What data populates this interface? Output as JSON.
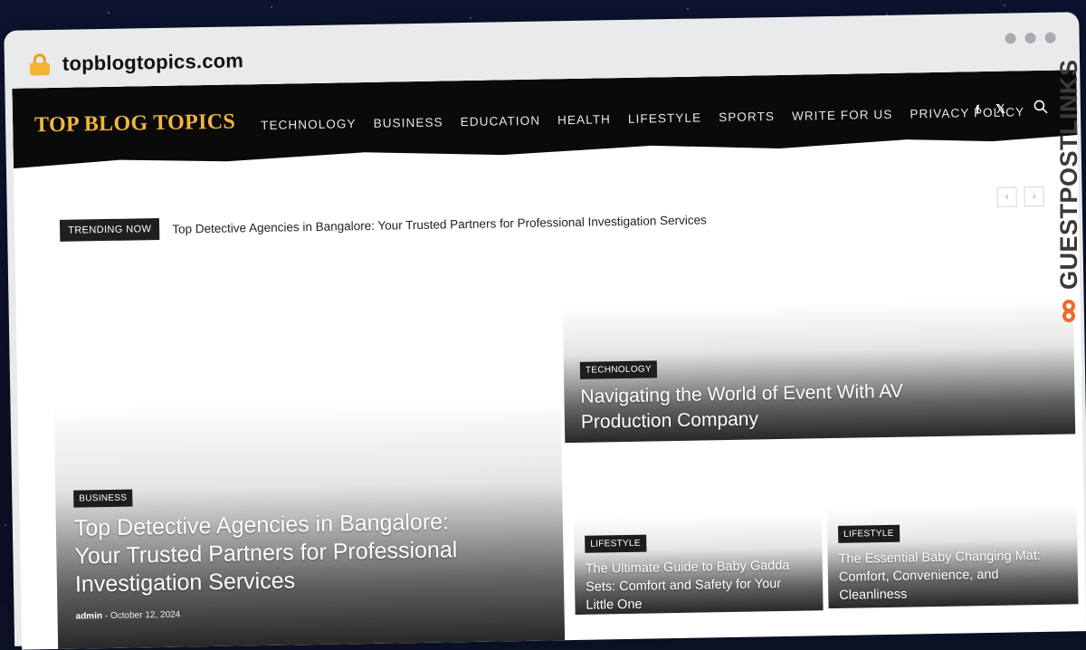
{
  "browser": {
    "url": "topblogtopics.com"
  },
  "site": {
    "logo": "TOP BLOG TOPICS",
    "nav": [
      "TECHNOLOGY",
      "BUSINESS",
      "EDUCATION",
      "HEALTH",
      "LIFESTYLE",
      "SPORTS",
      "WRITE FOR US",
      "PRIVACY POLICY"
    ],
    "social": {
      "facebook": "f",
      "x": "𝕏"
    }
  },
  "trending": {
    "badge": "TRENDING NOW",
    "headline": "Top Detective Agencies in Bangalore: Your Trusted Partners for Professional Investigation Services",
    "prev": "‹",
    "next": "›"
  },
  "featured": {
    "big": {
      "category": "BUSINESS",
      "title": "Top Detective Agencies in Bangalore: Your Trusted Partners for Professional Investigation Services",
      "author": "admin",
      "separator": "-",
      "date": "October 12, 2024"
    },
    "top_right": {
      "category": "TECHNOLOGY",
      "title": "Navigating the World of Event With AV Production Company"
    },
    "small_1": {
      "category": "LIFESTYLE",
      "title": "The Ultimate Guide to Baby Gadda Sets: Comfort and Safety for Your Little One"
    },
    "small_2": {
      "category": "LIFESTYLE",
      "title": "The Essential Baby Changing Mat: Comfort, Convenience, and Cleanliness"
    }
  },
  "watermark": {
    "text": "GUESTPOSTLINKS"
  },
  "colors": {
    "logo": "#f0b640",
    "header_bg": "#0a0a0a",
    "watermark_accent": "#ef6a2d"
  }
}
